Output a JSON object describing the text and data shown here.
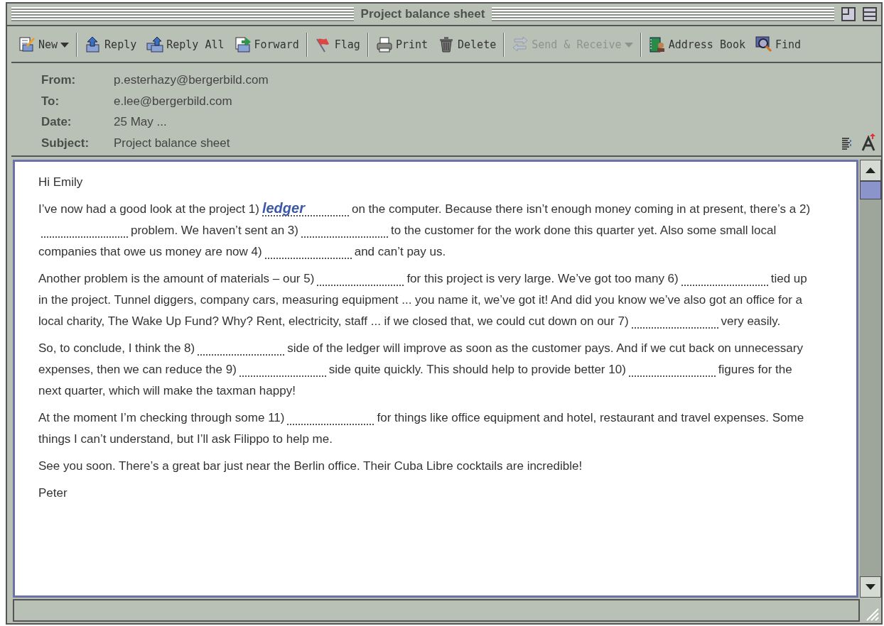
{
  "window": {
    "title": "Project balance sheet"
  },
  "toolbar": [
    {
      "kind": "new",
      "label": "New",
      "dropdown": true,
      "disabled": false
    },
    {
      "kind": "separator"
    },
    {
      "kind": "reply",
      "label": "Reply",
      "dropdown": false,
      "disabled": false
    },
    {
      "kind": "replyall",
      "label": "Reply All",
      "dropdown": false,
      "disabled": false
    },
    {
      "kind": "forward",
      "label": "Forward",
      "dropdown": false,
      "disabled": false
    },
    {
      "kind": "separator"
    },
    {
      "kind": "flag",
      "label": "Flag",
      "dropdown": false,
      "disabled": false
    },
    {
      "kind": "separator"
    },
    {
      "kind": "print",
      "label": "Print",
      "dropdown": false,
      "disabled": false
    },
    {
      "kind": "delete",
      "label": "Delete",
      "dropdown": false,
      "disabled": false
    },
    {
      "kind": "separator"
    },
    {
      "kind": "sync",
      "label": "Send & Receive",
      "dropdown": true,
      "disabled": true
    },
    {
      "kind": "separator"
    },
    {
      "kind": "addressbook",
      "label": "Address Book",
      "dropdown": false,
      "disabled": false
    },
    {
      "kind": "find",
      "label": "Find",
      "dropdown": false,
      "disabled": false
    }
  ],
  "header": [
    {
      "label": "From:",
      "value": "p.esterhazy@bergerbild.com"
    },
    {
      "label": "To:",
      "value": "e.lee@bergerbild.com"
    },
    {
      "label": "Date:",
      "value": "25 May ..."
    },
    {
      "label": "Subject:",
      "value": "Project balance sheet"
    }
  ],
  "body": [
    [
      {
        "kind": "text",
        "text": "Hi Emily"
      }
    ],
    [
      {
        "kind": "text",
        "text": "I’ve now had a good look at the project 1)"
      },
      {
        "kind": "blank",
        "answer": "ledger"
      },
      {
        "kind": "text",
        "text": "on the computer. Because there isn’t enough money coming in at present, there’s a 2)"
      },
      {
        "kind": "blank"
      },
      {
        "kind": "text",
        "text": "problem. We haven’t sent an 3)"
      },
      {
        "kind": "blank"
      },
      {
        "kind": "text",
        "text": "to the customer for the work done this quarter yet. Also some small local companies that owe us money are now 4)"
      },
      {
        "kind": "blank"
      },
      {
        "kind": "text",
        "text": "and can’t pay us."
      }
    ],
    [
      {
        "kind": "text",
        "text": "Another problem is the amount of materials – our 5)"
      },
      {
        "kind": "blank"
      },
      {
        "kind": "text",
        "text": "for this project is very large. We’ve got too many 6)"
      },
      {
        "kind": "blank"
      },
      {
        "kind": "text",
        "text": "tied up in the project. Tunnel diggers, company cars, measuring equipment ... you name it, we’ve got it! And did you know we’ve also got an office for a local charity, The Wake Up Fund? Why? Rent, electricity, staff ... if we closed that, we could cut down on our 7)"
      },
      {
        "kind": "blank"
      },
      {
        "kind": "text",
        "text": "very easily."
      }
    ],
    [
      {
        "kind": "text",
        "text": "So, to conclude, I think the 8)"
      },
      {
        "kind": "blank"
      },
      {
        "kind": "text",
        "text": "side of the ledger will improve as soon as the customer pays. And if we cut back on unnecessary expenses, then we can reduce the 9)"
      },
      {
        "kind": "blank"
      },
      {
        "kind": "text",
        "text": "side quite quickly. This should help to provide better 10)"
      },
      {
        "kind": "blank"
      },
      {
        "kind": "text",
        "text": "figures for the next quarter, which will make the taxman happy!"
      }
    ],
    [
      {
        "kind": "text",
        "text": "At the moment I’m checking through some 11)"
      },
      {
        "kind": "blank"
      },
      {
        "kind": "text",
        "text": "for things like office equipment and hotel, restaurant and travel expenses. Some things I can’t understand, but I’ll ask Filippo to help me."
      }
    ],
    [
      {
        "kind": "text",
        "text": "See you soon. There’s a great bar just near the Berlin office. Their Cuba Libre cocktails are incredible!"
      }
    ],
    [
      {
        "kind": "text",
        "text": "Peter"
      }
    ]
  ]
}
